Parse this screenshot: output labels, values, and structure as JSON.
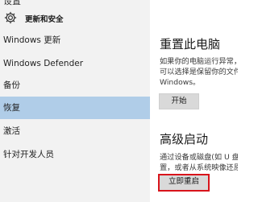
{
  "window": {
    "title_fragment": "设置"
  },
  "sidebar": {
    "header_label": "更新和安全",
    "items": [
      {
        "label": "Windows 更新"
      },
      {
        "label": "Windows Defender"
      },
      {
        "label": "备份"
      },
      {
        "label": "恢复",
        "selected": true
      },
      {
        "label": "激活"
      },
      {
        "label": "针对开发人员"
      }
    ]
  },
  "content": {
    "reset": {
      "heading": "重置此电脑",
      "lines": [
        "如果你的电脑运行异常，",
        "可以选择是保留你的文件",
        "Windows。"
      ],
      "button": "开始"
    },
    "advanced": {
      "heading": "高级启动",
      "lines": [
        "通过设备或磁盘(如 U 盘",
        "置，或者从系统映像还原"
      ],
      "button": "立即重启"
    }
  },
  "colors": {
    "selected_bg": "#b0cde8",
    "highlight_border": "#d8141b",
    "sidebar_bg": "#f2f2f2"
  }
}
